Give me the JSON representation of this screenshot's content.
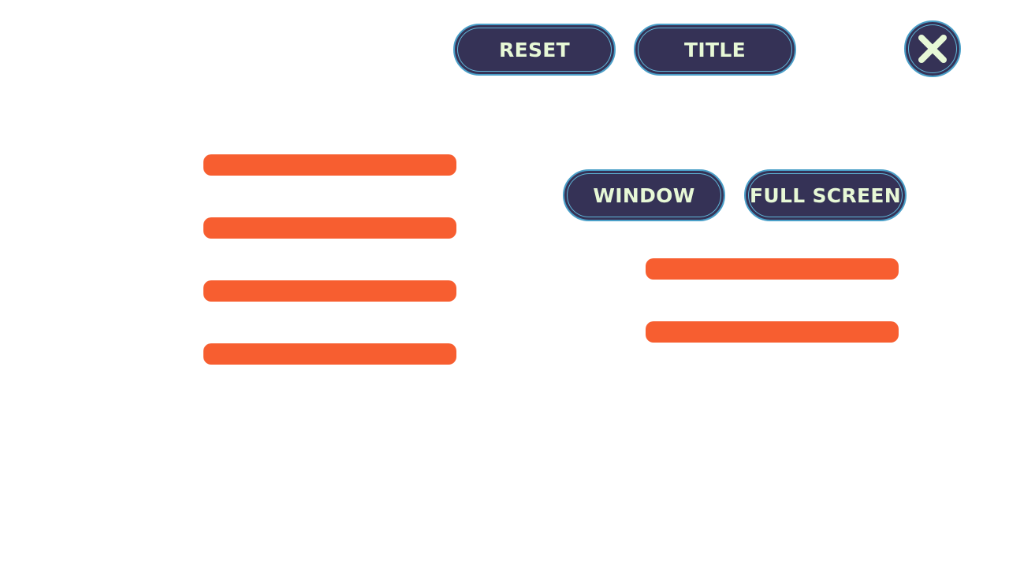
{
  "top_buttons": {
    "reset_label": "RESET",
    "title_label": "TITLE"
  },
  "display_buttons": {
    "window_label": "WINDOW",
    "fullscreen_label": "FULL SCREEN"
  },
  "close_icon": "close-icon",
  "colors": {
    "button_fill": "#353256",
    "button_text": "#e7f8d6",
    "button_outline": "#4a9fc8",
    "slider_bar": "#f75e30",
    "background": "#ffffff"
  },
  "left_bars_count_label": "",
  "right_bars_count_label": ""
}
